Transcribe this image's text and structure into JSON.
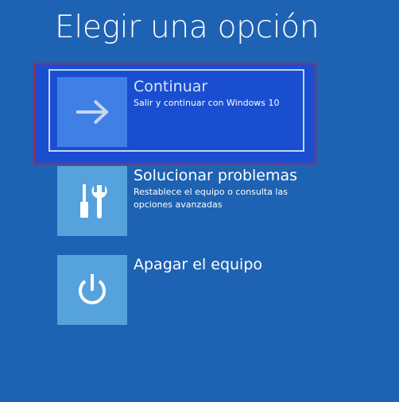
{
  "screen": {
    "title": "Elegir una opción"
  },
  "options": [
    {
      "title": "Continuar",
      "description": "Salir y continuar con Windows 10",
      "icon": "arrow-right-icon",
      "selected": true
    },
    {
      "title": "Solucionar problemas",
      "description": "Restablece el equipo o consulta las opciones avanzadas",
      "icon": "tools-icon",
      "selected": false
    },
    {
      "title": "Apagar el equipo",
      "description": "",
      "icon": "power-icon",
      "selected": false
    }
  ],
  "colors": {
    "background": "#1e62b3",
    "tile": "#55a2dc",
    "selected_tile": "#3f7fe6",
    "selected_background": "#1a4ed0",
    "focus_border": "#9e2a55"
  }
}
